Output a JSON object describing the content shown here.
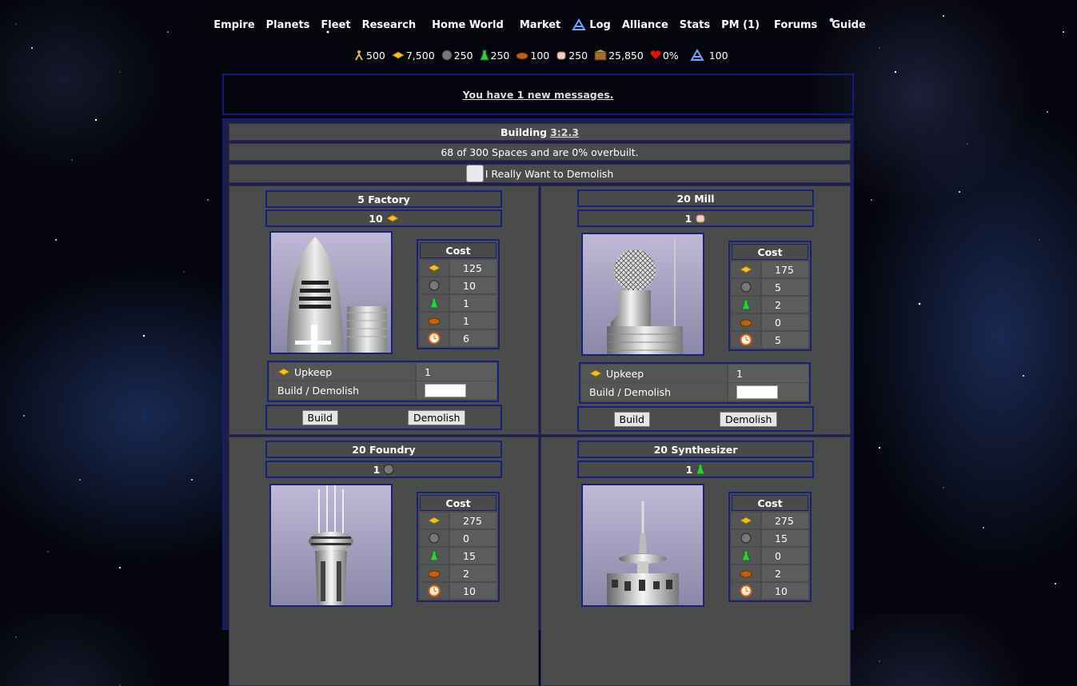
{
  "nav": [
    {
      "label": "Empire"
    },
    {
      "label": "Planets"
    },
    {
      "label": "Fleet"
    },
    {
      "label": "Research"
    },
    {
      "label": "Home World"
    },
    {
      "label": "Market"
    },
    {
      "label": "Log"
    },
    {
      "label": "Alliance"
    },
    {
      "label": "Stats"
    },
    {
      "label": "PM (1)"
    },
    {
      "label": "Forums"
    },
    {
      "label": "Guide"
    }
  ],
  "resources": [
    {
      "icon": "population-icon",
      "value": "500"
    },
    {
      "icon": "credits-icon",
      "value": "7,500"
    },
    {
      "icon": "ore-icon",
      "value": "250"
    },
    {
      "icon": "chemical-icon",
      "value": "250"
    },
    {
      "icon": "food-icon",
      "value": "100"
    },
    {
      "icon": "material-icon",
      "value": "250"
    },
    {
      "icon": "storage-icon",
      "value": "25,850"
    },
    {
      "icon": "heart-icon",
      "value": "0%"
    },
    {
      "icon": "fleet-icon",
      "value": "100"
    }
  ],
  "messages": {
    "text": "You have 1 new messages."
  },
  "building": {
    "title": "Building",
    "coords": "3:2.3",
    "spaces": "68 of 300 Spaces and are 0% overbuilt.",
    "demolish_label": "I Really Want to Demolish"
  },
  "labels": {
    "cost": "Cost",
    "upkeep": "Upkeep",
    "build_demolish": "Build / Demolish",
    "build": "Build",
    "demolish": "Demolish"
  },
  "buildings": [
    {
      "name": "5 Factory",
      "produce": "10",
      "produce_icon": "credits-icon",
      "costs": [
        "125",
        "10",
        "1",
        "1",
        "6"
      ],
      "upkeep": "1"
    },
    {
      "name": "20 Mill",
      "produce": "1",
      "produce_icon": "material-icon",
      "costs": [
        "175",
        "5",
        "2",
        "0",
        "5"
      ],
      "upkeep": "1"
    },
    {
      "name": "20 Foundry",
      "produce": "1",
      "produce_icon": "ore-icon",
      "costs": [
        "275",
        "0",
        "15",
        "2",
        "10"
      ],
      "upkeep": ""
    },
    {
      "name": "20 Synthesizer",
      "produce": "1",
      "produce_icon": "chemical-icon",
      "costs": [
        "275",
        "15",
        "0",
        "2",
        "10"
      ],
      "upkeep": ""
    }
  ],
  "colors": {
    "border": "#17207a",
    "panel": "#4b4b4b"
  }
}
